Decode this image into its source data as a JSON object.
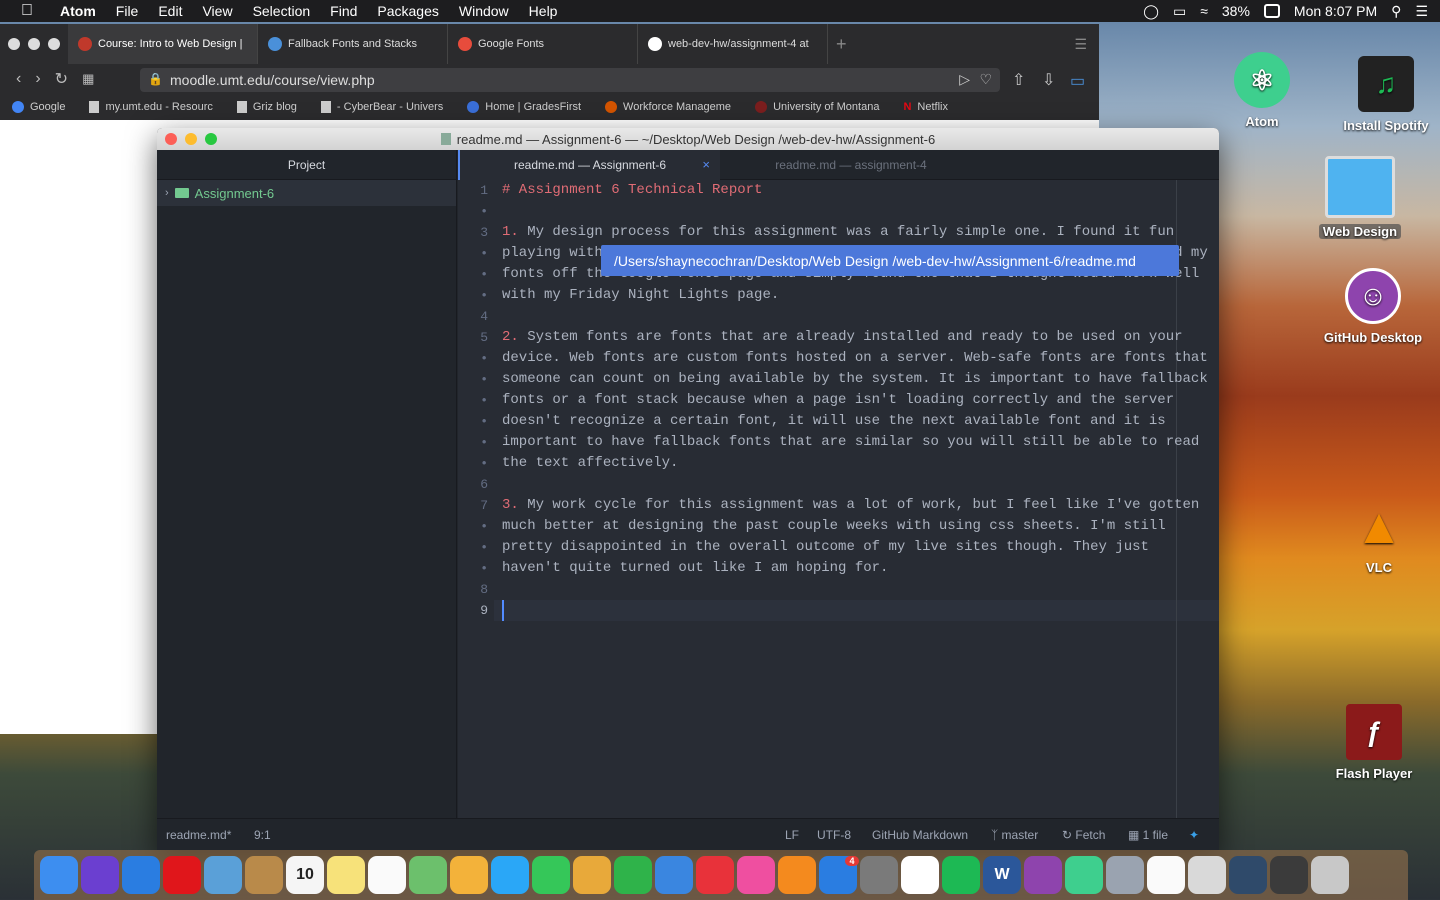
{
  "menubar": {
    "app_name": "Atom",
    "menus": [
      "File",
      "Edit",
      "View",
      "Selection",
      "Find",
      "Packages",
      "Window",
      "Help"
    ],
    "battery": "38%",
    "clock": "Mon 8:07 PM"
  },
  "browser": {
    "tabs": [
      {
        "label": "Course: Intro to Web Design |",
        "favicon_color": "#c0392b"
      },
      {
        "label": "Fallback Fonts and Stacks",
        "favicon_color": "#4a90d9"
      },
      {
        "label": "Google Fonts",
        "favicon_color": "#e74c3c"
      },
      {
        "label": "web-dev-hw/assignment-4 at",
        "favicon_color": "#ffffff"
      }
    ],
    "new_tab_symbol": "+",
    "url": "moodle.umt.edu/course/view.php",
    "url_domain": "umt.edu",
    "bookmarks": [
      "Google",
      "my.umt.edu - Resourc",
      "Griz blog",
      "- CyberBear - Univers",
      "Home | GradesFirst",
      "Workforce Manageme",
      "University of Montana",
      "Netflix"
    ]
  },
  "atom": {
    "window_title": "readme.md — Assignment-6 — ~/Desktop/Web Design /web-dev-hw/Assignment-6",
    "tree": {
      "header": "Project",
      "root": "Assignment-6"
    },
    "tabs": [
      {
        "label": "readme.md — Assignment-6",
        "active": true,
        "close": "×"
      },
      {
        "label": "readme.md — assignment-4",
        "active": false
      }
    ],
    "tooltip": "/Users/shaynecochran/Desktop/Web Design /web-dev-hw/Assignment-6/readme.md",
    "gutter": [
      "1",
      "•",
      "3",
      "•",
      "•",
      "•",
      "4",
      "5",
      "•",
      "•",
      "•",
      "•",
      "•",
      "•",
      "6",
      "7",
      "•",
      "•",
      "•",
      "8",
      "9"
    ],
    "lines": [
      {
        "kind": "heading",
        "text": "# Assignment 6 Technical Report"
      },
      {
        "kind": "item",
        "num": "1.",
        "text": " My design process for this assignment was a fairly simple one. I found it fun"
      },
      {
        "kind": "plain",
        "text": "playing with the different fonts and styles and learning more about css. I picked my"
      },
      {
        "kind": "plain",
        "text": "fonts off the Google Fonts page and simply found two that I thought would work well"
      },
      {
        "kind": "plain",
        "text": "with my Friday Night Lights page."
      },
      {
        "kind": "item",
        "num": "2.",
        "text": " System fonts are fonts that are already installed and ready to be used on your"
      },
      {
        "kind": "plain",
        "text": "device. Web fonts are custom fonts hosted on a server. Web-safe fonts are fonts that"
      },
      {
        "kind": "plain",
        "text": "someone can count on being available by the system. It is important to have fallback"
      },
      {
        "kind": "plain",
        "text": "fonts or a font stack because when a page isn't loading correctly and the server"
      },
      {
        "kind": "plain",
        "text": "doesn't recognize a certain font, it will use the next available font and it is"
      },
      {
        "kind": "plain",
        "text": "important to have fallback fonts that are similar so you will still be able to read"
      },
      {
        "kind": "plain",
        "text": "the text affectively."
      },
      {
        "kind": "item",
        "num": "3.",
        "text": " My work cycle for this assignment was a lot of work, but I feel like I've gotten"
      },
      {
        "kind": "plain",
        "text": "much better at designing the past couple weeks with using css sheets. I'm still"
      },
      {
        "kind": "plain",
        "text": "pretty disappointed in the overall outcome of my live sites though. They just"
      },
      {
        "kind": "plain",
        "text": "haven't quite turned out like I am hoping for."
      }
    ],
    "status": {
      "file": "readme.md*",
      "position": "9:1",
      "line_ending": "LF",
      "encoding": "UTF-8",
      "grammar": "GitHub Markdown",
      "branch": "master",
      "fetch": "Fetch",
      "files": "1 file"
    }
  },
  "desktop_icons": [
    {
      "label": "Atom",
      "color": "#3ecf8e",
      "glyph": "⚛"
    },
    {
      "label": "Install Spotify",
      "color": "#1db954",
      "glyph": "♫"
    },
    {
      "label": "Web Design",
      "color": "#4fb3f0",
      "glyph": "▭"
    },
    {
      "label": "GitHub Desktop",
      "color": "#8e44ad",
      "glyph": "☺"
    },
    {
      "label": "VLC",
      "color": "#f18a00",
      "glyph": "▲"
    },
    {
      "label": "Flash Player",
      "color": "#8b1a1a",
      "glyph": "ƒ"
    }
  ],
  "dock": [
    {
      "name": "finder",
      "color": "#3d8ef0"
    },
    {
      "name": "siri",
      "color": "#6b3fd0"
    },
    {
      "name": "safari",
      "color": "#2a7de1"
    },
    {
      "name": "opera",
      "color": "#e0161b"
    },
    {
      "name": "preview",
      "color": "#5aa0d8"
    },
    {
      "name": "contacts",
      "color": "#b98a4a"
    },
    {
      "name": "calendar",
      "color": "#f5f5f5",
      "text": "10"
    },
    {
      "name": "notes",
      "color": "#f7e27a"
    },
    {
      "name": "reminders",
      "color": "#fafafa"
    },
    {
      "name": "maps",
      "color": "#6cc06c"
    },
    {
      "name": "photos",
      "color": "#f3b23a"
    },
    {
      "name": "messages",
      "color": "#2aa7f7"
    },
    {
      "name": "facetime",
      "color": "#35c759"
    },
    {
      "name": "keynote",
      "color": "#e8a93a"
    },
    {
      "name": "numbers",
      "color": "#2fb34a"
    },
    {
      "name": "keynote-stand",
      "color": "#3a86e0"
    },
    {
      "name": "news",
      "color": "#e8323a"
    },
    {
      "name": "itunes",
      "color": "#ef4fa0"
    },
    {
      "name": "books",
      "color": "#f48a1e"
    },
    {
      "name": "app-store",
      "color": "#2a7de1",
      "badge": "4"
    },
    {
      "name": "system-preferences",
      "color": "#7a7a7a"
    },
    {
      "name": "solitaire",
      "color": "#ffffff"
    },
    {
      "name": "spotify",
      "color": "#1db954"
    },
    {
      "name": "word",
      "color": "#2b579a",
      "text": "W"
    },
    {
      "name": "github-desktop",
      "color": "#8e44ad"
    },
    {
      "name": "atom",
      "color": "#3ecf8e"
    },
    {
      "name": "image-capture",
      "color": "#9aa3b0"
    },
    {
      "name": "textedit",
      "color": "#fafafa"
    },
    {
      "name": "downloads-stack",
      "color": "#d9d9d9"
    },
    {
      "name": "screenshot-stack",
      "color": "#2f4a6a"
    },
    {
      "name": "recent-stack",
      "color": "#3b3b3b"
    },
    {
      "name": "trash",
      "color": "#c8c8c8"
    }
  ]
}
